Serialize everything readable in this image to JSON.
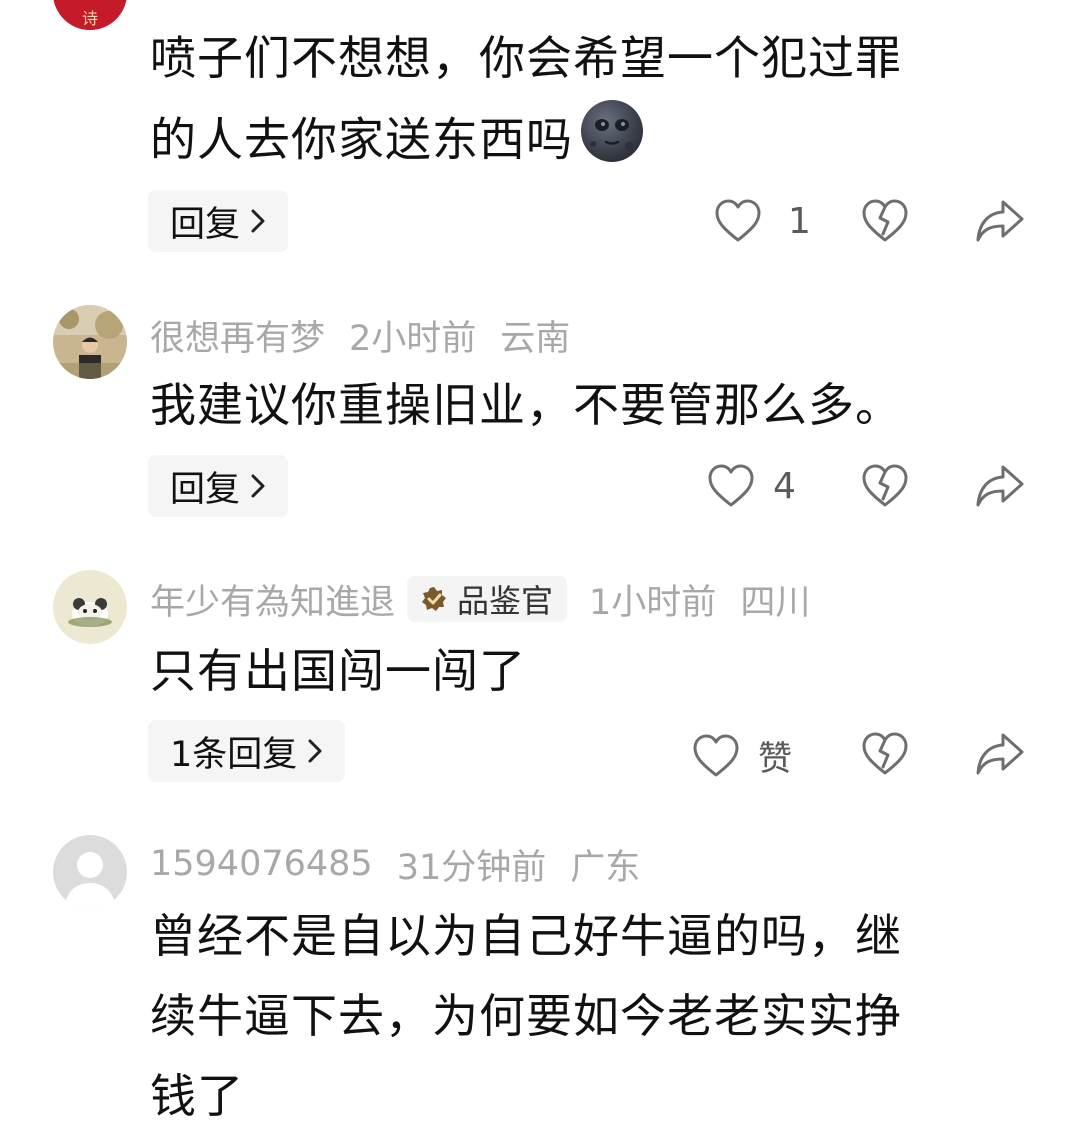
{
  "colors": {
    "meta_text": "#a8a8a8",
    "body_text": "#111111",
    "reply_bg": "#f5f5f5",
    "icon_stroke": "#6e6e6e",
    "badge_bg": "#f4f4f4",
    "badge_icon": "#7a5a2a"
  },
  "top_comment": {
    "text_lines": [
      "喷子们不想想，你会希望一个犯过罪",
      "的人去你家送东西吗"
    ],
    "emoji": "new-moon-face-emoji",
    "reply_label": "回复",
    "likes": "1"
  },
  "comments": [
    {
      "username": "很想再有梦",
      "time": "2小时前",
      "location": "云南",
      "text_lines": [
        "我建议你重操旧业，不要管那么多。"
      ],
      "reply_label": "回复",
      "likes": "4"
    },
    {
      "username": "年少有為知進退",
      "badge": "品鉴官",
      "time": "1小时前",
      "location": "四川",
      "text_lines": [
        "只有出国闯一闯了"
      ],
      "reply_label": "1条回复",
      "likes": "赞"
    },
    {
      "username": "1594076485",
      "time": "31分钟前",
      "location": "广东",
      "text_lines": [
        "曾经不是自以为自己好牛逼的吗，继",
        "续牛逼下去，为何要如今老老实实挣",
        "钱了"
      ]
    }
  ],
  "icons": {
    "like": "heart-outline-icon",
    "dislike": "broken-heart-icon",
    "share": "share-arrow-icon",
    "chevron": "chevron-right-icon",
    "badge": "verified-badge-icon"
  }
}
